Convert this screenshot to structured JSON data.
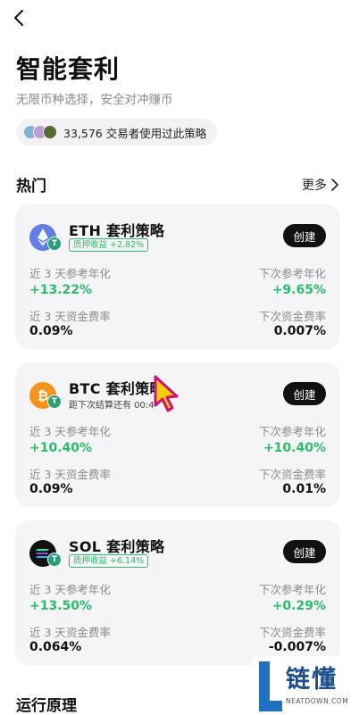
{
  "header": {
    "title": "智能套利",
    "subtitle": "无限币种选择，安全对冲赚币",
    "users_text": "33,576 交易者使用过此策略"
  },
  "section": {
    "title": "热门",
    "more_label": "更多"
  },
  "cards": [
    {
      "name": "ETH 套利策略",
      "tag": "质押收益 +2.82%",
      "create_label": "创建",
      "left_label_1": "近 3 天参考年化",
      "left_value_1": "+13.22%",
      "right_label_1": "下次参考年化",
      "right_value_1": "+9.65%",
      "left_label_2": "近 3 天资金费率",
      "left_value_2": "0.09%",
      "right_label_2": "下次资金费率",
      "right_value_2": "0.007%"
    },
    {
      "name": "BTC 套利策略",
      "tag": "距下次结算还有 00:4",
      "create_label": "创建",
      "left_label_1": "近 3 天参考年化",
      "left_value_1": "+10.40%",
      "right_label_1": "下次参考年化",
      "right_value_1": "+10.40%",
      "left_label_2": "近 3 天资金费率",
      "left_value_2": "0.09%",
      "right_label_2": "下次资金费率",
      "right_value_2": "0.01%"
    },
    {
      "name": "SOL 套利策略",
      "tag": "质押收益 +6.14%",
      "create_label": "创建",
      "left_label_1": "近 3 天参考年化",
      "left_value_1": "+13.50%",
      "right_label_1": "下次参考年化",
      "right_value_1": "+0.29%",
      "left_label_2": "近 3 天资金费率",
      "left_value_2": "0.064%",
      "right_label_2": "下次资金费率",
      "right_value_2": "-0.007%"
    }
  ],
  "footer": {
    "principle_title": "运行原理"
  },
  "watermark": {
    "text": "链懂",
    "sub": "NEATDOWN.COM"
  },
  "icons": {
    "back": "chevron-left-icon",
    "more": "chevron-right-icon",
    "eth": "eth-coin-icon",
    "btc": "btc-coin-icon",
    "sol": "sol-coin-icon",
    "tether": "tether-icon"
  },
  "colors": {
    "positive": "#2bbd6b",
    "card_bg": "#f5f5f7",
    "button_bg": "#111111",
    "eth": "#627eea",
    "btc": "#f7931a",
    "tether": "#26a17b"
  }
}
